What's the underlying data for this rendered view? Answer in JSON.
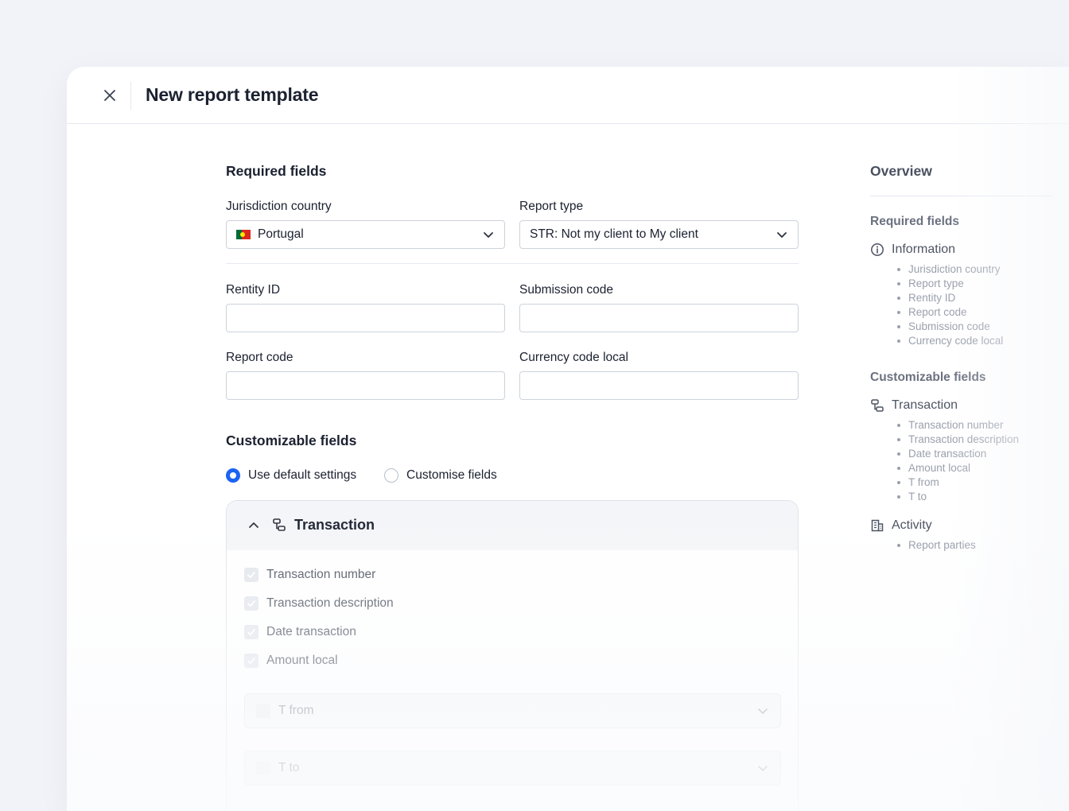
{
  "header": {
    "title": "New report template"
  },
  "required": {
    "title": "Required fields",
    "jurisdiction": {
      "label": "Jurisdiction country",
      "value": "Portugal"
    },
    "report_type": {
      "label": "Report type",
      "value": "STR: Not my client to My client"
    },
    "rentity_id": {
      "label": "Rentity ID",
      "value": ""
    },
    "submission_code": {
      "label": "Submission code",
      "value": ""
    },
    "report_code": {
      "label": "Report code",
      "value": ""
    },
    "currency_code_local": {
      "label": "Currency code local",
      "value": ""
    }
  },
  "customizable": {
    "title": "Customizable fields",
    "options": [
      "Use default settings",
      "Customise fields"
    ],
    "selected": "Use default settings",
    "panel": {
      "title": "Transaction",
      "checks": [
        "Transaction number",
        "Transaction description",
        "Date transaction",
        "Amount local"
      ],
      "sub_selects": [
        "T from",
        "T to"
      ]
    }
  },
  "overview": {
    "title": "Overview",
    "required_title": "Required fields",
    "information": {
      "label": "Information",
      "items": [
        "Jurisdiction country",
        "Report type",
        "Rentity ID",
        "Report code",
        "Submission code",
        "Currency code local"
      ]
    },
    "customizable_title": "Customizable fields",
    "transaction": {
      "label": "Transaction",
      "items": [
        "Transaction number",
        "Transaction description",
        "Date transaction",
        "Amount local",
        "T from",
        "T to"
      ]
    },
    "activity": {
      "label": "Activity",
      "items": [
        "Report parties"
      ]
    }
  },
  "colors": {
    "accent": "#1c63f2",
    "text": "#1b2130",
    "border": "#cdd2db"
  },
  "icons": {
    "close": "close-icon",
    "chevron": "chevron-down-icon",
    "collapse": "chevron-up-icon",
    "transaction": "transaction-icon",
    "information": "info-icon",
    "activity": "building-icon"
  }
}
